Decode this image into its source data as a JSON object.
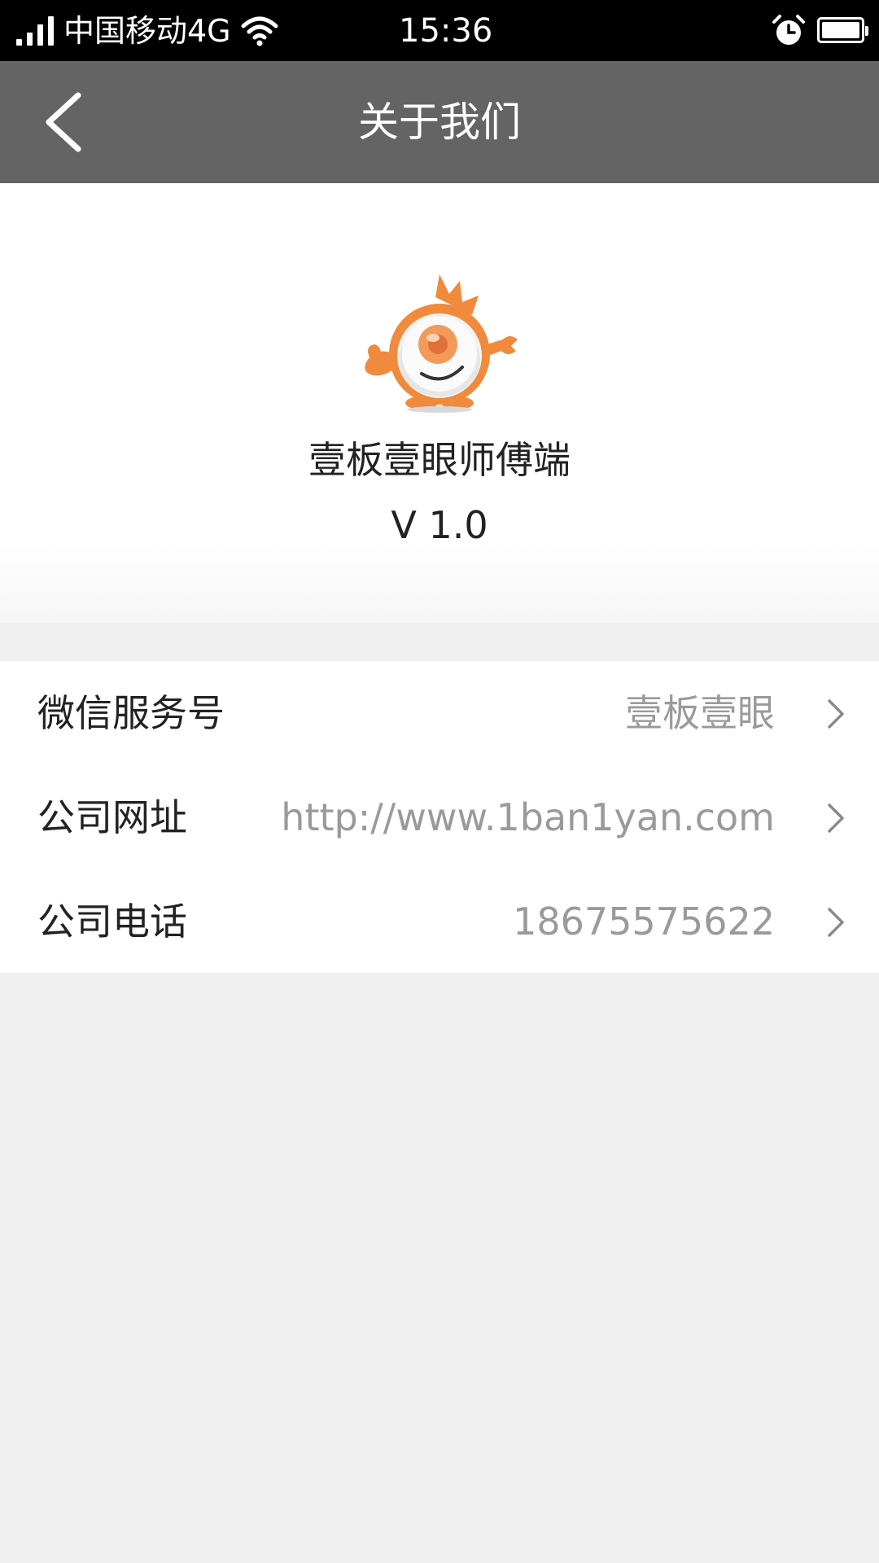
{
  "status_bar": {
    "carrier": "中国移动4G",
    "time": "15:36"
  },
  "nav": {
    "title": "关于我们",
    "back_icon": "chevron-left-icon"
  },
  "about": {
    "app_name": "壹板壹眼师傅端",
    "version": "V 1.0",
    "logo_colors": {
      "orange": "#f08a3c",
      "eye_white": "#f2f2f2"
    }
  },
  "info_rows": [
    {
      "label": "微信服务号",
      "value": "壹板壹眼"
    },
    {
      "label": "公司网址",
      "value": "http://www.1ban1yan.com"
    },
    {
      "label": "公司电话",
      "value": "18675575622"
    }
  ],
  "colors": {
    "status_bar_bg": "#000000",
    "nav_bar_bg": "#646464",
    "page_bg": "#efefef",
    "value_text": "#9a9a9a"
  }
}
